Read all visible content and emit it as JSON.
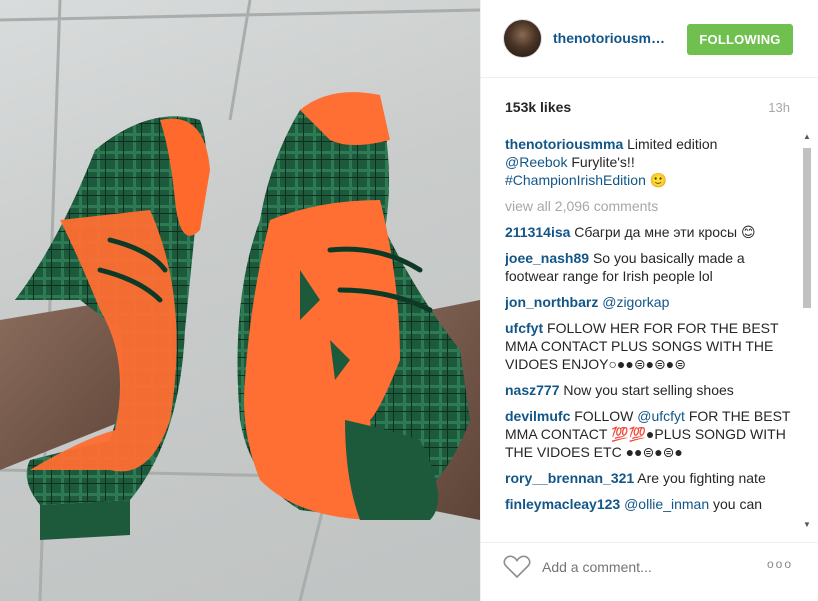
{
  "post": {
    "username": "thenotoriousmm..",
    "follow_label": "FOLLOWING",
    "likes": "153k likes",
    "time": "13h",
    "caption": {
      "user": "thenotoriousmma",
      "text": " Limited edition",
      "mention": "@Reebok",
      "text2": " Furylite's!!",
      "hashtag": "#ChampionIrishEdition",
      "emoji": " 🙂"
    },
    "view_all": "view all 2,096 comments"
  },
  "comments": [
    {
      "user": "211314isa",
      "text": " Сбагри да мне эти кросы 😊"
    },
    {
      "user": "joee_nash89",
      "text": " So you basically made a footwear range for Irish people lol"
    },
    {
      "user": "jon_northbarz",
      "mention": " @zigorkap",
      "text": ""
    },
    {
      "user": "ufcfyt",
      "text": " FOLLOW HER FOR FOR THE BEST MMA CONTACT PLUS SONGS WITH THE VIDOES ENJOY○●●⊜●⊜●⊜"
    },
    {
      "user": "nasz777",
      "text": " Now you start selling shoes"
    },
    {
      "user": "devilmufc",
      "text": " FOLLOW ",
      "mention": "@ufcfyt",
      "text2": " FOR THE BEST MMA CONTACT 💯💯●PLUS SONGD WITH THE VIDOES ETC ●●⊜●⊜●"
    },
    {
      "user": "rory__brennan_321",
      "text": " Are you fighting nate"
    },
    {
      "user": "finleymacleay123",
      "mention": " @ollie_inman",
      "text": " you can"
    }
  ],
  "footer": {
    "placeholder": "Add a comment...",
    "more": "ooo",
    "heart_icon": "heart-outline-icon"
  },
  "colors": {
    "link": "#125688",
    "follow_green": "#70c050",
    "muted": "#a5a7aa"
  }
}
